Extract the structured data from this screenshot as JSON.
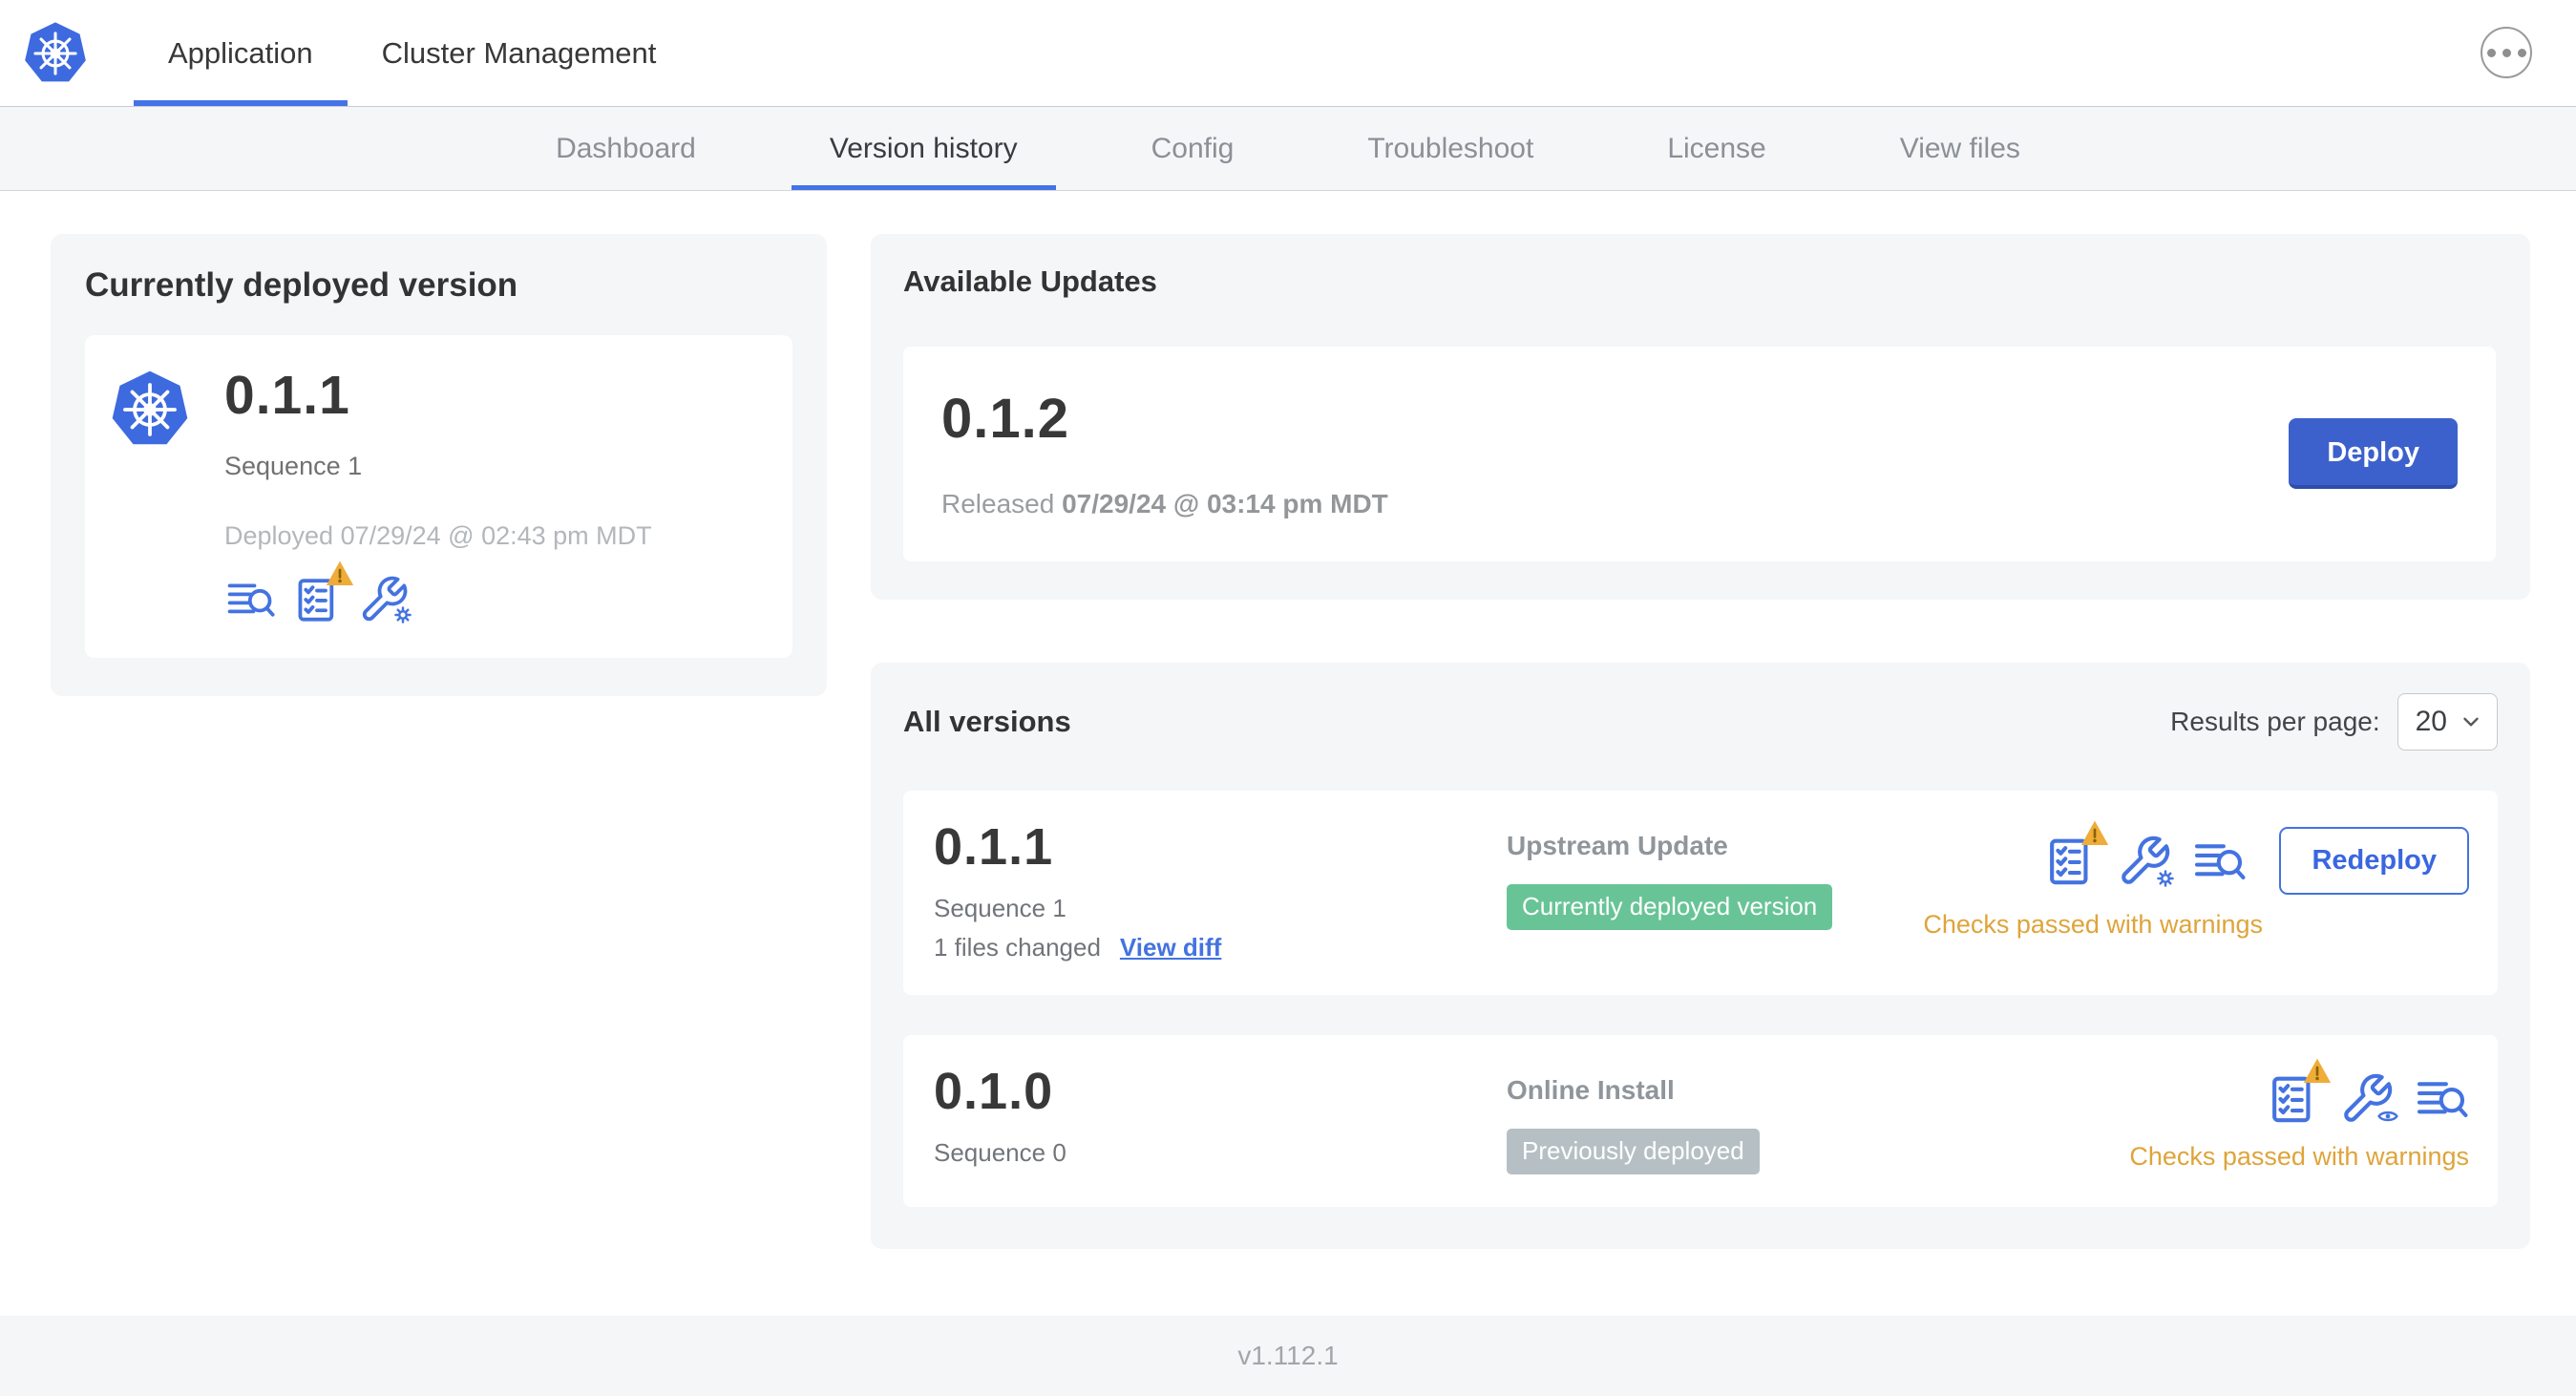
{
  "header": {
    "app_tab": "Application",
    "cluster_tab": "Cluster Management"
  },
  "subnav": {
    "items": [
      "Dashboard",
      "Version history",
      "Config",
      "Troubleshoot",
      "License",
      "View files"
    ],
    "active": "Version history"
  },
  "current": {
    "title": "Currently deployed version",
    "version": "0.1.1",
    "sequence": "Sequence 1",
    "deployed": "Deployed 07/29/24 @ 02:43 pm MDT"
  },
  "available": {
    "title": "Available Updates",
    "version": "0.1.2",
    "released_label": "Released",
    "released_date": "07/29/24 @ 03:14 pm MDT",
    "deploy_label": "Deploy"
  },
  "all_versions": {
    "title": "All versions",
    "per_page_label": "Results per page:",
    "per_page_value": "20",
    "rows": [
      {
        "version": "0.1.1",
        "sequence": "Sequence 1",
        "files_changed": "1 files changed",
        "view_diff_label": "View diff",
        "source": "Upstream Update",
        "badge": "Currently deployed version",
        "badge_bg": "#68c496",
        "checks": "Checks passed with warnings",
        "action_label": "Redeploy"
      },
      {
        "version": "0.1.0",
        "sequence": "Sequence 0",
        "source": "Online Install",
        "badge": "Previously deployed",
        "badge_bg": "#b6c0c4",
        "checks": "Checks passed with warnings"
      }
    ]
  },
  "footer": {
    "version": "v1.112.1"
  },
  "icons": {
    "logo": "kubernetes-logo",
    "more": "ellipsis-menu-icon",
    "logs": "view-logs-icon",
    "preflight": "preflight-checks-warning-icon",
    "edit_config": "edit-config-wrench-gear-icon",
    "view_config": "view-config-wrench-eye-icon",
    "chevron": "chevron-down-icon"
  },
  "colors": {
    "primary_blue": "#3d61cc",
    "icon_link_blue": "#4473e0",
    "active_underline_blue": "#4473e8",
    "logo_blue": "#3e6ae0",
    "success_green": "#68c496",
    "neutral_badge_gray": "#b6c0c4",
    "warning_amber": "#dfa43a",
    "card_gray": "#f4f6f8"
  }
}
